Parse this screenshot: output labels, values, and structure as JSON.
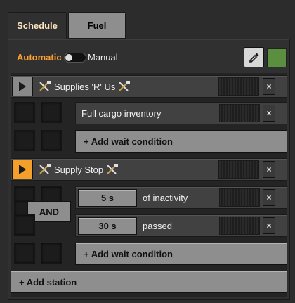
{
  "tabs": [
    {
      "label": "Schedule",
      "active": true
    },
    {
      "label": "Fuel",
      "active": false
    }
  ],
  "mode": {
    "automatic_label": "Automatic",
    "manual_label": "Manual",
    "toggle_state": "manual"
  },
  "colors": {
    "accent": "#ffa12b",
    "train_color": "#5a8f3f"
  },
  "stations": [
    {
      "name": "Supplies 'R' Us",
      "active": false,
      "conditions": [
        {
          "text": "Full cargo inventory"
        }
      ],
      "add_condition_label": "+ Add wait condition"
    },
    {
      "name": "Supply Stop",
      "active": true,
      "conditions": [
        {
          "value": "5 s",
          "text": "of inactivity"
        },
        {
          "value": "30 s",
          "text": "passed"
        }
      ],
      "comparator_label": "AND",
      "add_condition_label": "+ Add wait condition"
    }
  ],
  "add_station_label": "+ Add station",
  "close_glyph": "×"
}
